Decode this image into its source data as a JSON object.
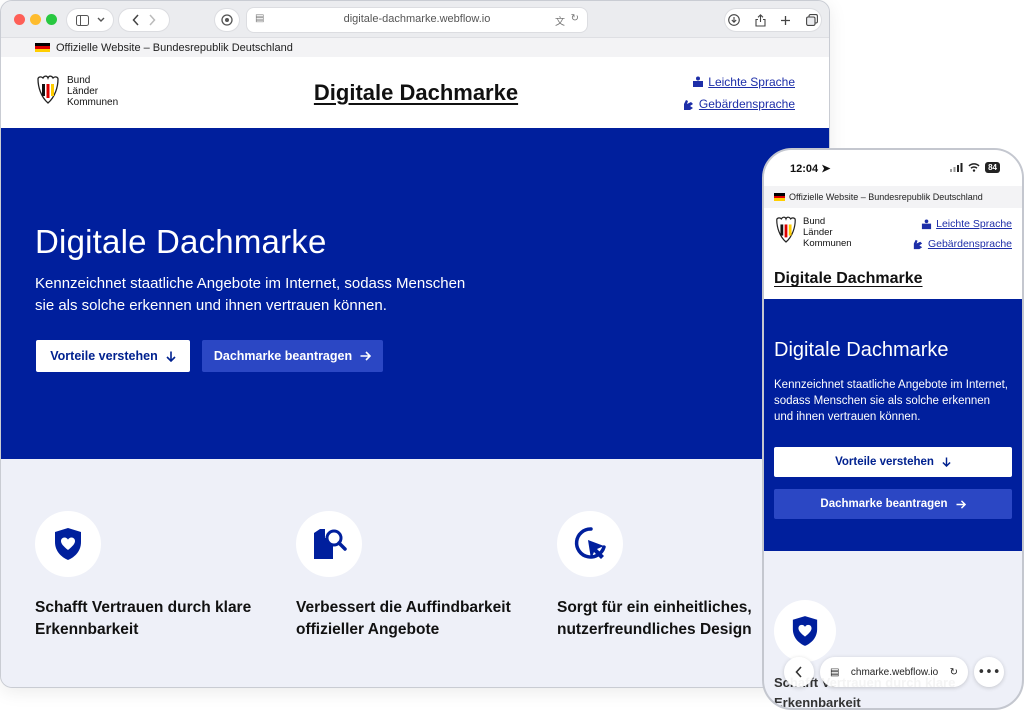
{
  "browser": {
    "url": "digitale-dachmarke.webflow.io"
  },
  "gov_bar": {
    "text": "Offizielle Website – Bundesrepublik Deutschland"
  },
  "header": {
    "logo_lines": [
      "Bund",
      "Länder",
      "Kommunen"
    ],
    "title": "Digitale Dachmarke",
    "links": {
      "easy_language": "Leichte Sprache",
      "sign_language": "Gebärdensprache"
    }
  },
  "hero": {
    "title": "Digitale Dachmarke",
    "text": "Kennzeichnet staatliche Angebote im Internet, sodass Menschen sie als solche erkennen und ihnen vertrauen können.",
    "primary_button": "Vorteile verstehen",
    "secondary_button": "Dachmarke beantragen"
  },
  "features": [
    {
      "icon": "shield-heart-icon",
      "text": "Schafft Vertrauen durch klare Erkennbarkeit"
    },
    {
      "icon": "document-search-icon",
      "text": "Verbessert die Auffindbarkeit offizieller Angebote"
    },
    {
      "icon": "cursor-click-icon",
      "text": "Sorgt für ein einheitliches, nutzerfreundliches Design"
    }
  ],
  "phone": {
    "time": "12:04",
    "battery": "84",
    "url": "chmarke.webflow.io"
  },
  "colors": {
    "brand_blue": "#001f9d",
    "button_blue": "#2b47c4",
    "link_blue": "#1d2ea8",
    "feature_bg": "#eef0f8"
  }
}
